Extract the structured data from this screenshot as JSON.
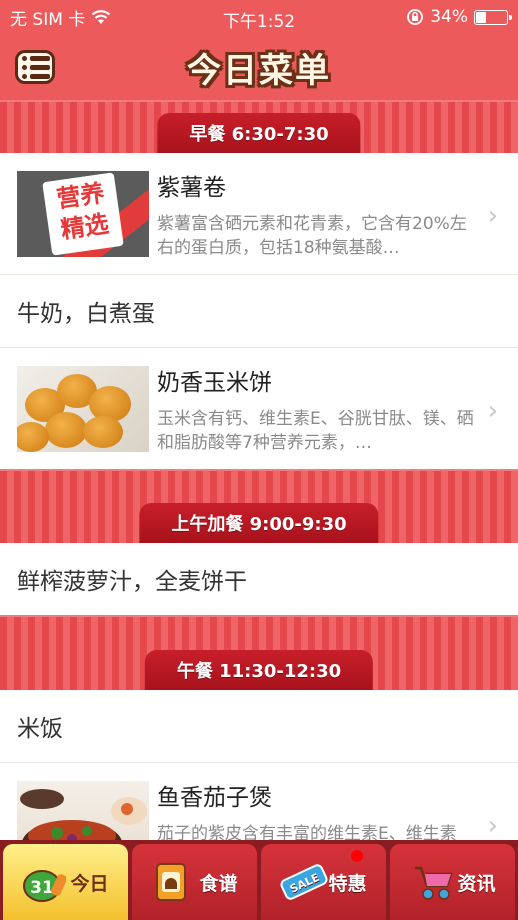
{
  "status_bar": {
    "carrier": "无 SIM 卡",
    "time": "下午1:52",
    "battery_percent": "34%",
    "battery_level": 0.34
  },
  "header": {
    "title": "今日菜单"
  },
  "sections": [
    {
      "title": "早餐 6:30-7:30",
      "dish1": {
        "name": "紫薯卷",
        "desc": "紫薯富含硒元素和花青素，它含有20%左右的蛋白质，包括18种氨基酸…",
        "thumb_text": "营养精选"
      },
      "text1": "牛奶，白煮蛋",
      "dish2": {
        "name": "奶香玉米饼",
        "desc": "玉米含有钙、维生素E、谷胱甘肽、镁、硒和脂肪酸等7种营养元素，…"
      }
    },
    {
      "title": "上午加餐 9:00-9:30",
      "text1": "鲜榨菠萝汁，全麦饼干"
    },
    {
      "title": "午餐 11:30-12:30",
      "text1": "米饭",
      "dish1": {
        "name": "鱼香茄子煲",
        "desc": "茄子的紫皮含有丰富的维生素E、维生素P…"
      }
    }
  ],
  "tabs": [
    {
      "label": "今日",
      "icon": "calendar-31-icon",
      "icon_text": "31"
    },
    {
      "label": "食谱",
      "icon": "recipe-book-icon"
    },
    {
      "label": "特惠",
      "icon": "sale-tag-icon",
      "icon_text": "SALE"
    },
    {
      "label": "资讯",
      "icon": "stroller-icon"
    }
  ],
  "colors": {
    "primary_red": "#ec5a5c",
    "header_dark_red": "#b2222a",
    "title_brown": "#6b3016",
    "active_tab_yellow": "#f4c02e"
  }
}
